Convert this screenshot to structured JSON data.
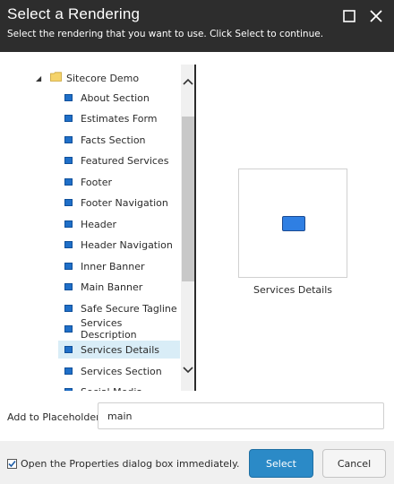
{
  "dialog": {
    "title": "Select a Rendering",
    "subtitle": "Select the rendering that you want to use. Click Select to continue."
  },
  "tree": {
    "root_label": "Sitecore Demo",
    "items": [
      {
        "label": "About Section",
        "selected": false
      },
      {
        "label": "Estimates Form",
        "selected": false
      },
      {
        "label": "Facts Section",
        "selected": false
      },
      {
        "label": "Featured Services",
        "selected": false
      },
      {
        "label": "Footer",
        "selected": false
      },
      {
        "label": "Footer Navigation",
        "selected": false
      },
      {
        "label": "Header",
        "selected": false
      },
      {
        "label": "Header Navigation",
        "selected": false
      },
      {
        "label": "Inner Banner",
        "selected": false
      },
      {
        "label": "Main Banner",
        "selected": false
      },
      {
        "label": "Safe Secure Tagline",
        "selected": false
      },
      {
        "label": "Services Description",
        "selected": false
      },
      {
        "label": "Services Details",
        "selected": true
      },
      {
        "label": "Services Section",
        "selected": false
      },
      {
        "label": "Social Media",
        "selected": false
      }
    ]
  },
  "preview": {
    "label": "Services Details"
  },
  "placeholder": {
    "label": "Add to Placeholder:",
    "value": "main"
  },
  "footer": {
    "checkbox_label": "Open the Properties dialog box immediately.",
    "checkbox_checked": true,
    "select_label": "Select",
    "cancel_label": "Cancel"
  },
  "colors": {
    "titlebar": "#2d2d2d",
    "accent": "#2b8ac7",
    "selection": "#d9edf7"
  }
}
